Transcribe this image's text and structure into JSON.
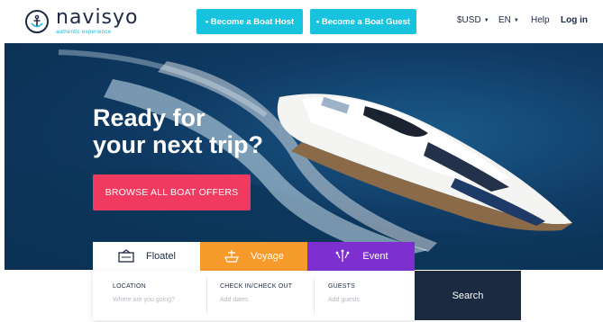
{
  "header": {
    "logo": {
      "word": "navisyo",
      "tagline": "authentic experience"
    },
    "become_host": "• Become a Boat Host",
    "become_guest": "• Become a Boat Guest",
    "currency": "$USD",
    "language": "EN",
    "help": "Help",
    "login": "Log in"
  },
  "hero": {
    "title_line1": "Ready for",
    "title_line2": "your next trip?",
    "browse_button": "BROWSE ALL BOAT OFFERS"
  },
  "search": {
    "tabs": [
      {
        "label": "Floatel",
        "color": "#ffffff",
        "icon": "floatel-icon",
        "active": true
      },
      {
        "label": "Voyage",
        "color": "#f79a2c",
        "icon": "voyage-icon",
        "active": false
      },
      {
        "label": "Event",
        "color": "#7d2fd0",
        "icon": "event-icon",
        "active": false
      }
    ],
    "fields": [
      {
        "label": "LOCATION",
        "placeholder": "Where are you going?"
      },
      {
        "label": "CHECK IN/CHECK OUT",
        "placeholder": "Add dates"
      },
      {
        "label": "GUESTS",
        "placeholder": "Add guests"
      }
    ],
    "submit": "Search"
  },
  "colors": {
    "accent_cyan": "#18c3e0",
    "cta_pink": "#f03a5f",
    "navy": "#1b2a40"
  }
}
